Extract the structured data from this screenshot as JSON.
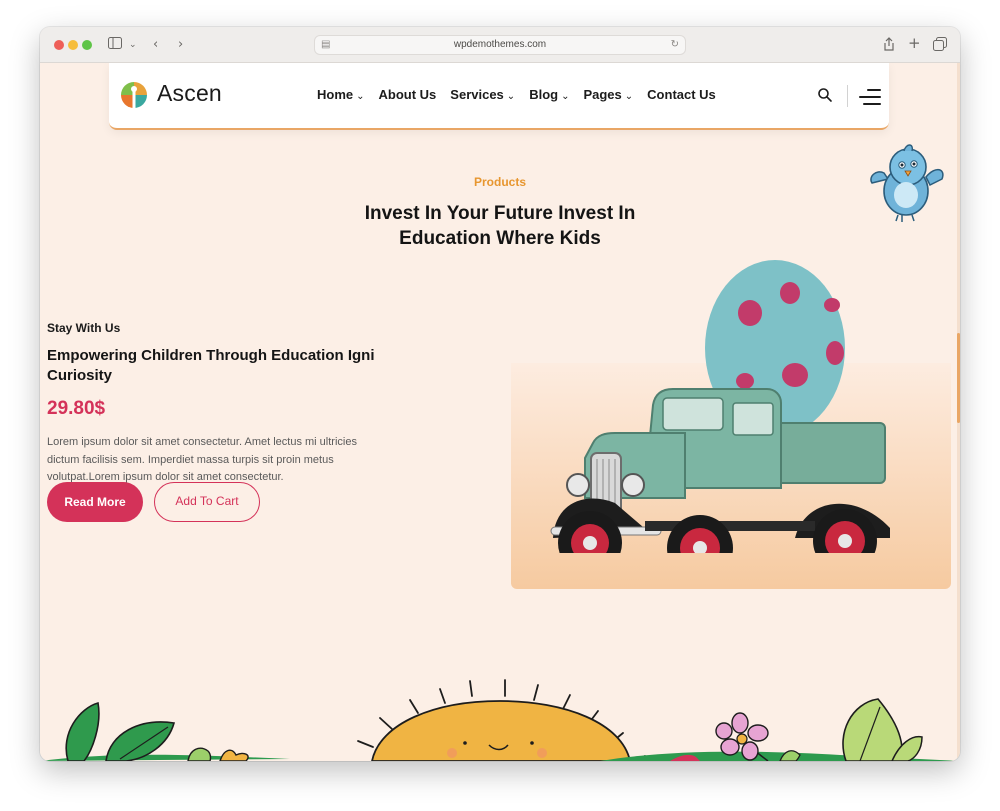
{
  "browser": {
    "url": "wpdemothemes.com"
  },
  "header": {
    "logo_text": "Ascen",
    "menu": [
      {
        "label": "Home",
        "has_dropdown": true
      },
      {
        "label": "About Us",
        "has_dropdown": false
      },
      {
        "label": "Services",
        "has_dropdown": true
      },
      {
        "label": "Blog",
        "has_dropdown": true
      },
      {
        "label": "Pages",
        "has_dropdown": true
      },
      {
        "label": "Contact Us",
        "has_dropdown": false
      }
    ],
    "search_icon": "search-icon",
    "menu_icon": "hamburger-icon"
  },
  "section": {
    "tag": "Products",
    "title_line1": "Invest In Your Future Invest In",
    "title_line2": "Education Where Kids"
  },
  "product": {
    "eyebrow": "Stay With Us",
    "name": "Empowering Children Through Education Igni Curiosity",
    "price": "29.80$",
    "description": "Lorem ipsum dolor sit amet consectetur. Amet lectus mi ultricies dictum facilisis sem. Imperdiet massa turpis sit proin metus volutpat.Lorem ipsum dolor sit amet consectetur.",
    "read_more_label": "Read More",
    "add_to_cart_label": "Add To Cart",
    "image": "toy-truck-with-egg"
  },
  "colors": {
    "accent": "#d43259",
    "orange": "#e9a665",
    "page_bg": "#fcefe6"
  }
}
